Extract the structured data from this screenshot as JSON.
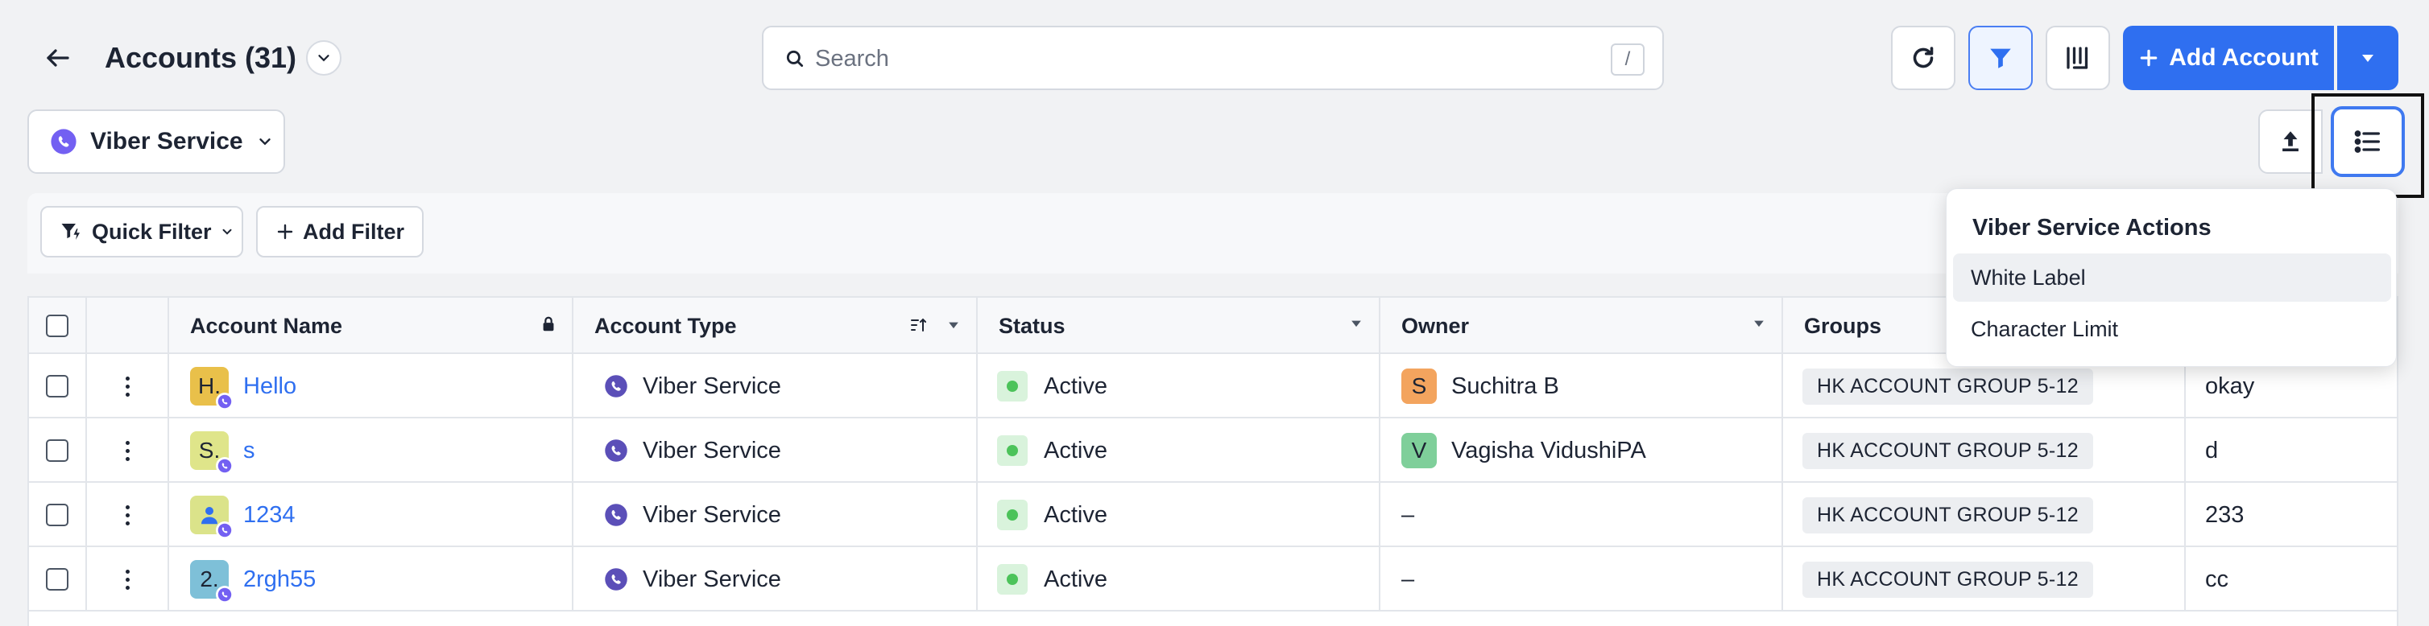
{
  "header": {
    "title": "Accounts (31)",
    "search_placeholder": "Search",
    "search_shortcut": "/",
    "add_account_label": "Add Account"
  },
  "service_select": {
    "label": "Viber Service"
  },
  "filters": {
    "quick_filter": "Quick Filter",
    "add_filter": "Add Filter"
  },
  "table": {
    "columns": [
      "Account Name",
      "Account Type",
      "Status",
      "Owner",
      "Groups"
    ],
    "rows": [
      {
        "avatar": "H.",
        "avatar_color": "#e9c04a",
        "name": "Hello",
        "type": "Viber Service",
        "status": "Active",
        "owner_initial": "S",
        "owner_color": "#f3a45e",
        "owner": "Suchitra B",
        "group": "HK ACCOUNT GROUP 5-12",
        "extra": "okay"
      },
      {
        "avatar": "S.",
        "avatar_color": "#dfe58a",
        "name": "s",
        "type": "Viber Service",
        "status": "Active",
        "owner_initial": "V",
        "owner_color": "#7fcf9a",
        "owner": "Vagisha VidushiPA",
        "group": "HK ACCOUNT GROUP 5-12",
        "extra": "d"
      },
      {
        "avatar": "",
        "avatar_color": "#dbe38a",
        "name": "1234",
        "type": "Viber Service",
        "status": "Active",
        "owner_initial": "",
        "owner_color": "",
        "owner": "–",
        "group": "HK ACCOUNT GROUP 5-12",
        "extra": "233"
      },
      {
        "avatar": "2.",
        "avatar_color": "#7ec0d8",
        "name": "2rgh55",
        "type": "Viber Service",
        "status": "Active",
        "owner_initial": "",
        "owner_color": "",
        "owner": "–",
        "group": "HK ACCOUNT GROUP 5-12",
        "extra": "cc"
      }
    ]
  },
  "menu": {
    "title": "Viber Service Actions",
    "items": [
      "White Label",
      "Character Limit"
    ]
  },
  "colors": {
    "primary": "#2f6ff0",
    "viber": "#7360f2",
    "active": "#4cc35a"
  }
}
